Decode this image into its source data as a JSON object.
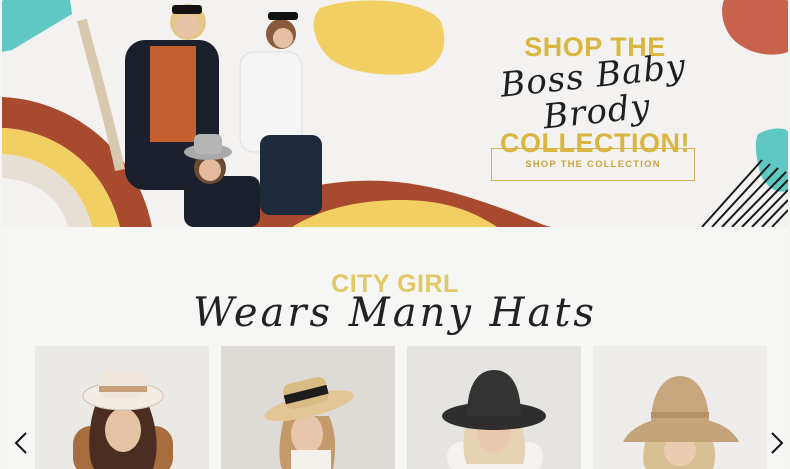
{
  "hero": {
    "title_line1": "SHOP THE",
    "title_script": "Boss Baby Brody",
    "title_line2": "COLLECTION!",
    "button_label": "SHOP THE COLLECTION",
    "colors": {
      "gold": "#d9b642",
      "rust": "#a84a2e",
      "yellow": "#f2cf62",
      "teal": "#5fc8c3",
      "terracotta": "#c9624a"
    }
  },
  "section": {
    "title": "CITY GIRL",
    "script": "Wears Many Hats"
  },
  "carousel": {
    "prev_icon": "chevron-left-icon",
    "next_icon": "chevron-right-icon",
    "products": [
      {
        "name": "cream-fedora-hat",
        "hat_color": "#f2ece4",
        "band_color": "#c7a07a"
      },
      {
        "name": "straw-boater-hat",
        "hat_color": "#e2c795",
        "band_color": "#1d1d1d"
      },
      {
        "name": "black-bucket-hat",
        "hat_color": "#2e2e2e",
        "band_color": "#2e2e2e"
      },
      {
        "name": "crochet-bucket-hat",
        "hat_color": "#c4a27a",
        "band_color": "#b4926a"
      }
    ]
  }
}
